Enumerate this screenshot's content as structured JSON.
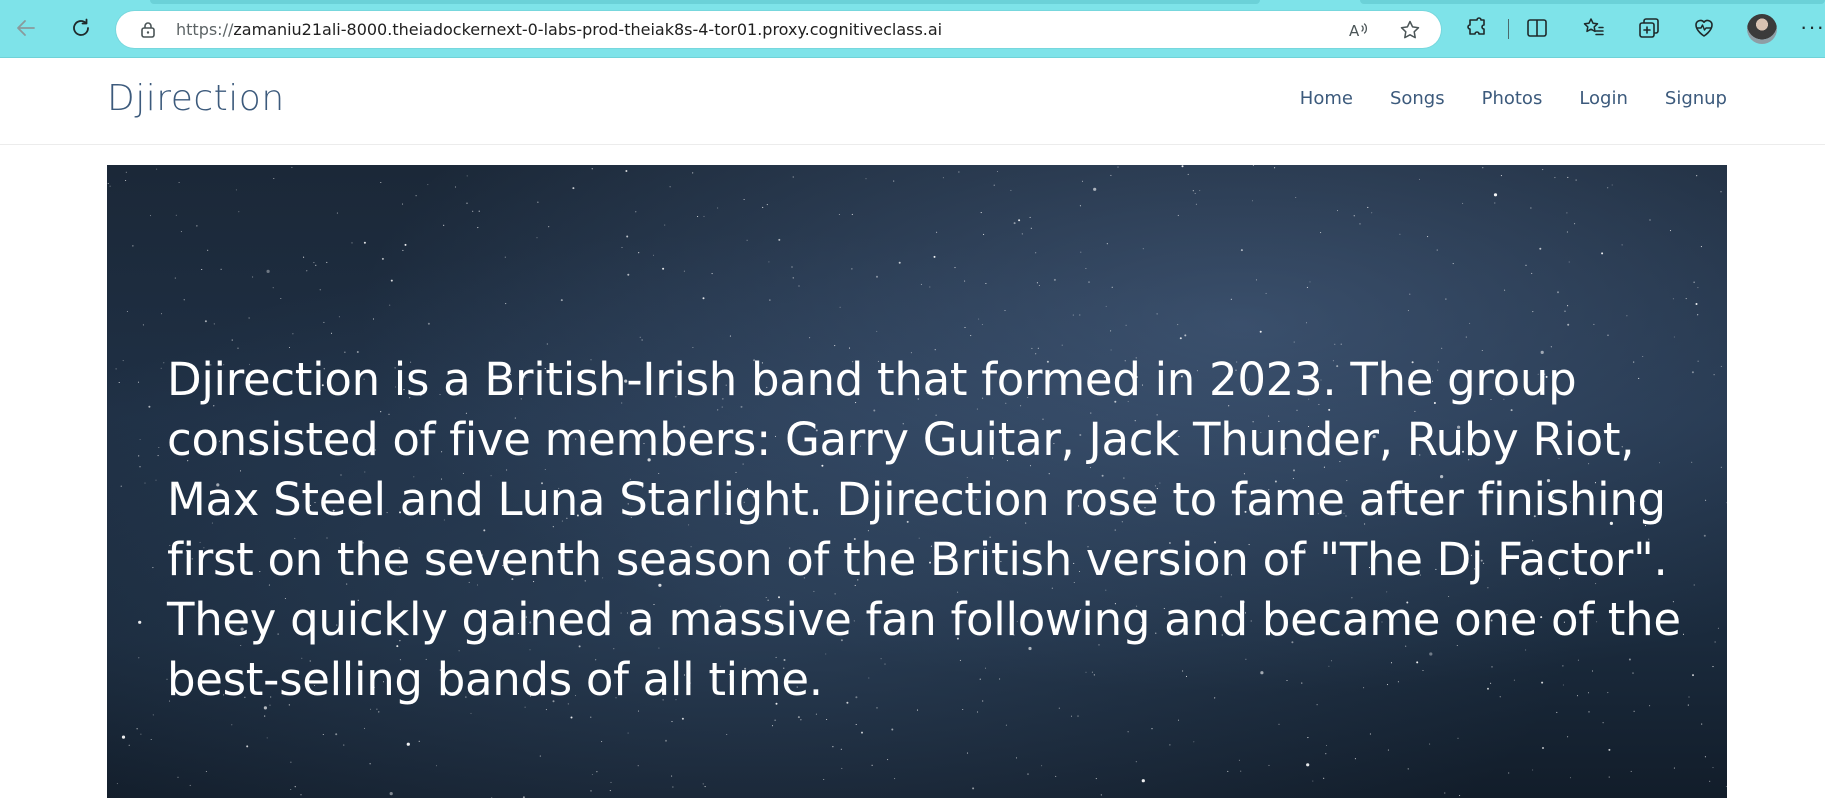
{
  "browser": {
    "url_scheme": "https://",
    "url_host": "zamaniu21ali-8000.theiadockernext-0-labs-prod-theiak8s-4-tor01.proxy.cognitiveclass.ai",
    "back_icon": "arrow-left-icon",
    "refresh_icon": "refresh-icon",
    "lock_icon": "lock-icon",
    "read_aloud_icon": "read-aloud-icon",
    "favorite_icon": "star-icon",
    "extensions_icon": "puzzle-icon",
    "split_icon": "split-screen-icon",
    "favorites_icon": "favorites-list-icon",
    "collections_icon": "collections-icon",
    "health_icon": "heart-pulse-icon",
    "more_label": "···",
    "accent_color": "#7ee3e9"
  },
  "site": {
    "brand": "Djirection",
    "nav": [
      "Home",
      "Songs",
      "Photos",
      "Login",
      "Signup"
    ],
    "link_color": "#3c5a7c"
  },
  "hero": {
    "text": "Djirection is a British-Irish band that formed in 2023. The group consisted of five members: Garry Guitar, Jack Thunder, Ruby Riot, Max Steel and Luna Starlight. Djirection rose to fame after finishing first on the seventh season of the British version of \"The Dj Factor\". They quickly gained a massive fan following and became one of the best-selling bands of all time."
  }
}
